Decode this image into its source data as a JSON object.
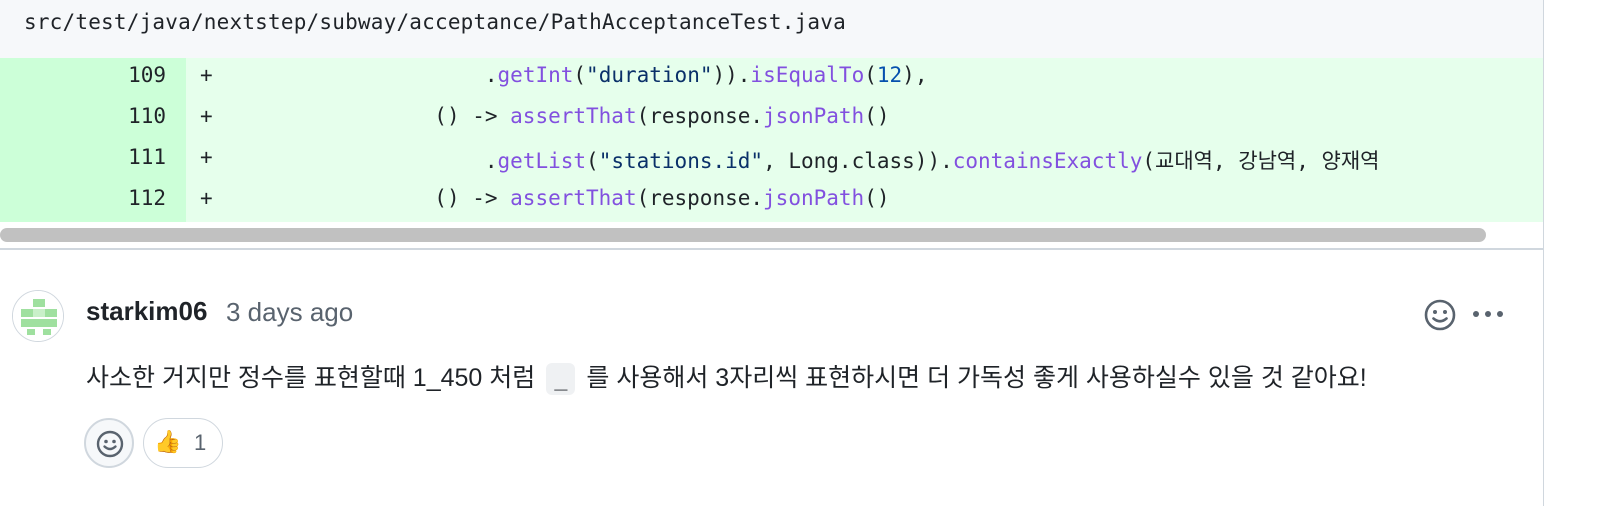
{
  "file": {
    "path": "src/test/java/nextstep/subway/acceptance/PathAcceptanceTest.java"
  },
  "diff": {
    "marker": "+",
    "lines": [
      {
        "number": "109",
        "indent": "                    ",
        "segments": [
          {
            "type": "plain",
            "text": "."
          },
          {
            "type": "fn",
            "text": "getInt"
          },
          {
            "type": "plain",
            "text": "("
          },
          {
            "type": "str",
            "text": "\"duration\""
          },
          {
            "type": "plain",
            "text": "))."
          },
          {
            "type": "fn",
            "text": "isEqualTo"
          },
          {
            "type": "plain",
            "text": "("
          },
          {
            "type": "num",
            "text": "12"
          },
          {
            "type": "plain",
            "text": "),"
          }
        ]
      },
      {
        "number": "110",
        "indent": "                ",
        "segments": [
          {
            "type": "plain",
            "text": "() -> "
          },
          {
            "type": "fn",
            "text": "assertThat"
          },
          {
            "type": "plain",
            "text": "(response."
          },
          {
            "type": "fn",
            "text": "jsonPath"
          },
          {
            "type": "plain",
            "text": "()"
          }
        ]
      },
      {
        "number": "111",
        "indent": "                    ",
        "segments": [
          {
            "type": "plain",
            "text": "."
          },
          {
            "type": "fn",
            "text": "getList"
          },
          {
            "type": "plain",
            "text": "("
          },
          {
            "type": "str",
            "text": "\"stations.id\""
          },
          {
            "type": "plain",
            "text": ", Long.class))."
          },
          {
            "type": "fn",
            "text": "containsExactly"
          },
          {
            "type": "plain",
            "text": "(교대역, 강남역, 양재역"
          }
        ]
      },
      {
        "number": "112",
        "indent": "                ",
        "segments": [
          {
            "type": "plain",
            "text": "() -> "
          },
          {
            "type": "fn",
            "text": "assertThat"
          },
          {
            "type": "plain",
            "text": "(response."
          },
          {
            "type": "fn",
            "text": "jsonPath"
          },
          {
            "type": "plain",
            "text": "()"
          }
        ]
      }
    ]
  },
  "comment": {
    "author": "starkim06",
    "time": "3 days ago",
    "body_before": "사소한 거지만 정수를 표현할때 1_450 처럼",
    "body_code": "_",
    "body_after": "를 사용해서 3자리씩 표현하시면 더 가독성 좋게 사용하실수 있을 것 같아요!",
    "reactions": [
      {
        "emoji": "👍",
        "count": "1"
      }
    ]
  },
  "icons": {
    "avatar": "identicon-avatar",
    "add_reaction": "smiley-icon",
    "more": "kebab-horizontal-icon",
    "thumbs_up": "thumbs-up-emoji"
  },
  "colors": {
    "diff_added_bg": "#e6ffec",
    "diff_added_gutter": "#ccffd8",
    "function": "#8250df",
    "string": "#0a3069",
    "number": "#0550ae",
    "muted_text": "#59636e"
  }
}
